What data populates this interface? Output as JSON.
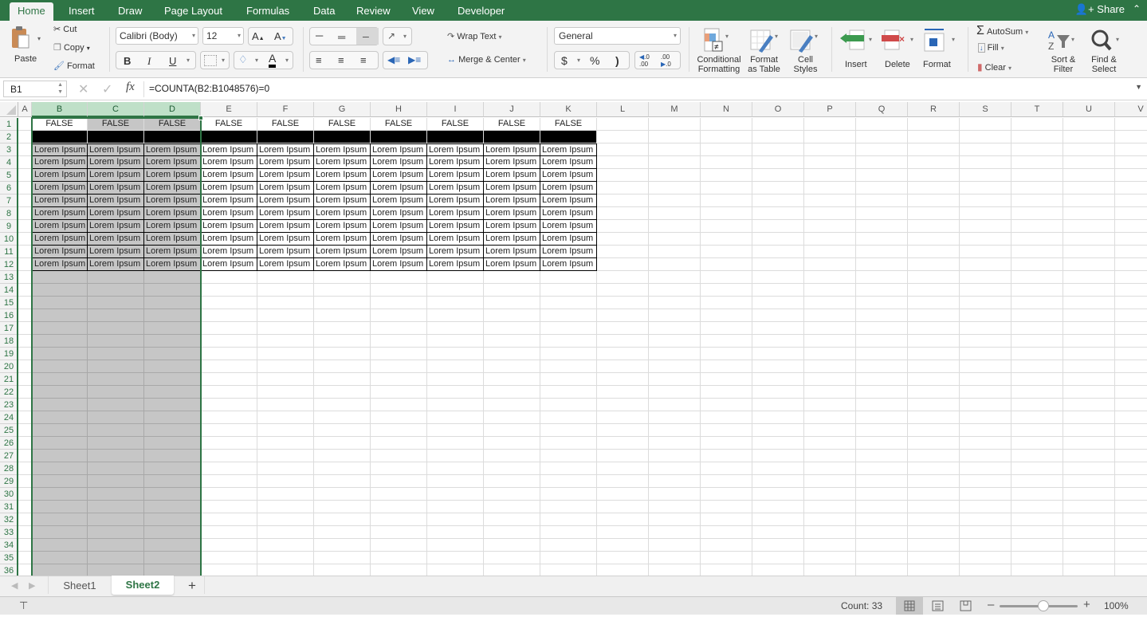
{
  "ribbon_tabs": [
    "Home",
    "Insert",
    "Draw",
    "Page Layout",
    "Formulas",
    "Data",
    "Review",
    "View",
    "Developer"
  ],
  "active_tab": "Home",
  "share_label": "Share",
  "clipboard": {
    "paste": "Paste",
    "cut": "Cut",
    "copy": "Copy",
    "format": "Format"
  },
  "font": {
    "name": "Calibri (Body)",
    "size": "12",
    "bold": "B",
    "italic": "I",
    "underline": "U"
  },
  "alignment": {
    "wrap_text": "Wrap Text",
    "merge_center": "Merge & Center"
  },
  "number": {
    "format": "General",
    "currency": "$",
    "percent": "%",
    "comma": ")",
    "inc_decimal": ".0\n.00",
    "dec_decimal": ".00\n.0"
  },
  "styles": {
    "conditional": [
      "Conditional",
      "Formatting"
    ],
    "format_table": [
      "Format",
      "as Table"
    ],
    "cell_styles": [
      "Cell",
      "Styles"
    ]
  },
  "cells_group": {
    "insert": "Insert",
    "delete": "Delete",
    "format": "Format"
  },
  "editing": {
    "autosum": "AutoSum",
    "fill": "Fill",
    "clear": "Clear",
    "sort": [
      "Sort &",
      "Filter"
    ],
    "find": [
      "Find &",
      "Select"
    ]
  },
  "formula_bar": {
    "name_box": "B1",
    "fx": "fx",
    "formula": "=COUNTA(B2:B1048576)=0"
  },
  "columns": [
    "A",
    "B",
    "C",
    "D",
    "E",
    "F",
    "G",
    "H",
    "I",
    "J",
    "K",
    "L",
    "M",
    "N",
    "O",
    "P",
    "Q",
    "R",
    "S",
    "T",
    "U",
    "V"
  ],
  "selected_columns": [
    "B",
    "C",
    "D"
  ],
  "rows": [
    "1",
    "2",
    "3",
    "4",
    "5",
    "6",
    "7",
    "8",
    "9",
    "10",
    "11",
    "12",
    "13",
    "14",
    "15",
    "16",
    "17",
    "18",
    "19",
    "20",
    "21",
    "22",
    "23",
    "24",
    "25",
    "26",
    "27",
    "28",
    "29",
    "30",
    "31",
    "32",
    "33",
    "34",
    "35",
    "36"
  ],
  "cells": {
    "row1_value": "FALSE",
    "body_value": "Lorem Ipsum"
  },
  "sheets": [
    "Sheet1",
    "Sheet2"
  ],
  "active_sheet": "Sheet2",
  "add_sheet": "+",
  "status": {
    "count": "Count: 33",
    "zoom": "100%",
    "zoom_level_percent": 100
  }
}
